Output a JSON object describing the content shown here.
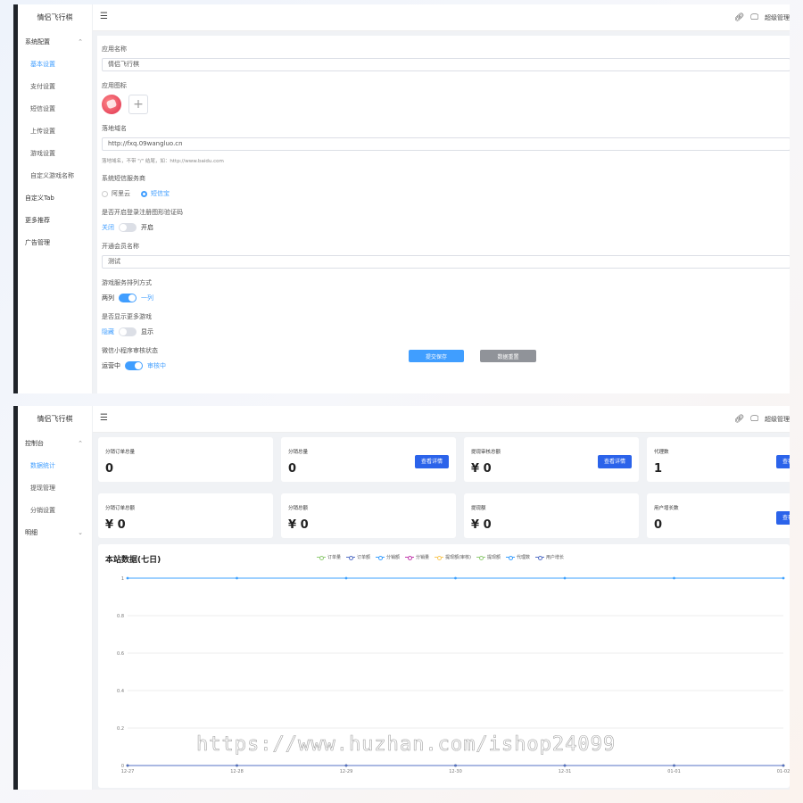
{
  "app_name": "情侣飞行棋",
  "topbar": {
    "user_label": "超级管理"
  },
  "settings_sidebar": [
    {
      "label": "系统配置",
      "level": "group",
      "expanded": true
    },
    {
      "label": "基本设置",
      "level": "sub",
      "active": true
    },
    {
      "label": "支付设置",
      "level": "sub"
    },
    {
      "label": "短信设置",
      "level": "sub"
    },
    {
      "label": "上传设置",
      "level": "sub"
    },
    {
      "label": "游戏设置",
      "level": "sub"
    },
    {
      "label": "自定义游戏名称",
      "level": "sub"
    },
    {
      "label": "自定义Tab",
      "level": "group"
    },
    {
      "label": "更多推荐",
      "level": "group"
    },
    {
      "label": "广告管理",
      "level": "group"
    }
  ],
  "form": {
    "app_name_label": "应用名称",
    "app_name_value": "情侣飞行棋",
    "app_icon_label": "应用图标",
    "domain_label": "落地域名",
    "domain_value": "http://fxq.09wangluo.cn",
    "domain_hint": "落地域名，不带 \"/\" 结尾，如：http://www.baidu.com",
    "sms_label": "系统短信服务商",
    "sms_option_1": "阿里云",
    "sms_option_2": "短信宝",
    "sms_selected": "短信宝",
    "captcha_label": "是否开启登录注册图形验证码",
    "captcha_off": "关闭",
    "captcha_on": "开启",
    "captcha_enabled": false,
    "member_label": "开通会员名称",
    "member_value": "测试",
    "layout_label": "游戏服务排列方式",
    "layout_left": "两列",
    "layout_right": "一列",
    "layout_one_column": true,
    "more_label": "是否显示更多游戏",
    "more_off": "隐藏",
    "more_on": "显示",
    "more_enabled": false,
    "review_label": "微信小程序审核状态",
    "review_left": "运营中",
    "review_right": "审核中",
    "review_enabled": true,
    "submit_label": "提交保存",
    "reset_label": "数据重置"
  },
  "dashboard_sidebar": [
    {
      "label": "控制台",
      "level": "group",
      "expanded": true
    },
    {
      "label": "数据统计",
      "level": "sub",
      "active": true
    },
    {
      "label": "提现管理",
      "level": "sub"
    },
    {
      "label": "分销设置",
      "level": "sub"
    },
    {
      "label": "明细",
      "level": "group",
      "collapsed": true
    }
  ],
  "cards": [
    {
      "title": "分销订单总量",
      "value": "0"
    },
    {
      "title": "分销总量",
      "value": "0",
      "button": "查看详情"
    },
    {
      "title": "提现审核总额",
      "value": "¥ 0",
      "button": "查看详情"
    },
    {
      "title": "代理数",
      "value": "1",
      "button": "查看详"
    },
    {
      "title": "分销订单总额",
      "value": "¥ 0"
    },
    {
      "title": "分销总额",
      "value": "¥ 0"
    },
    {
      "title": "提现额",
      "value": "¥ 0"
    },
    {
      "title": "用户增长数",
      "value": "0",
      "button": "查看详"
    }
  ],
  "chart_data": {
    "type": "line",
    "title": "本站数据(七日)",
    "categories": [
      "12-27",
      "12-28",
      "12-29",
      "12-30",
      "12-31",
      "01-01",
      "01-02"
    ],
    "ylim": [
      0,
      1
    ],
    "yticks": [
      "0",
      "0.2",
      "0.4",
      "0.6",
      "0.8",
      "1"
    ],
    "grid": true,
    "legend_position": "top",
    "series": [
      {
        "name": "订单量",
        "color": "#91cc75",
        "values": [
          0,
          0,
          0,
          0,
          0,
          0,
          0
        ]
      },
      {
        "name": "订单额",
        "color": "#5470c6",
        "values": [
          0,
          0,
          0,
          0,
          0,
          0,
          0
        ]
      },
      {
        "name": "分销额",
        "color": "#3ba0ff",
        "values": [
          0,
          0,
          0,
          0,
          0,
          0,
          0
        ]
      },
      {
        "name": "分销量",
        "color": "#c23cae",
        "values": [
          0,
          0,
          0,
          0,
          0,
          0,
          0
        ]
      },
      {
        "name": "提现额(审核)",
        "color": "#fac858",
        "values": [
          0,
          0,
          0,
          0,
          0,
          0,
          0
        ]
      },
      {
        "name": "提现额",
        "color": "#91cc75",
        "values": [
          0,
          0,
          0,
          0,
          0,
          0,
          0
        ]
      },
      {
        "name": "代理数",
        "color": "#3ba0ff",
        "values": [
          1,
          1,
          1,
          1,
          1,
          1,
          1
        ]
      },
      {
        "name": "用户增长",
        "color": "#5470c6",
        "values": [
          0,
          0,
          0,
          0,
          0,
          0,
          0
        ]
      }
    ]
  },
  "watermark": "https://www.huzhan.com/ishop24099"
}
